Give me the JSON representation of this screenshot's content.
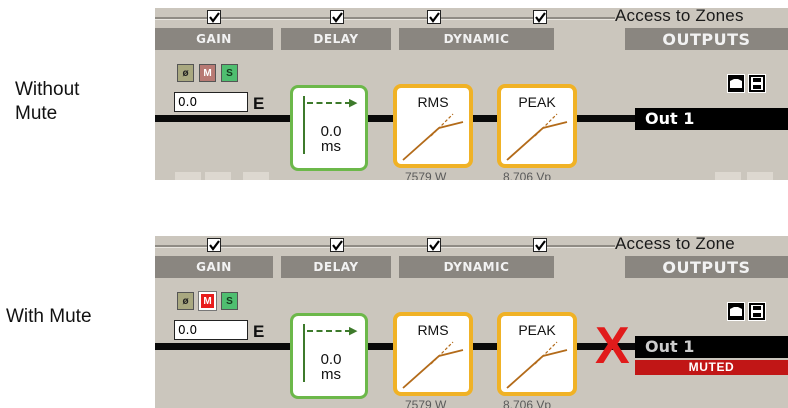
{
  "captions": {
    "top": [
      "Without",
      "Mute"
    ],
    "bottom": "With Mute"
  },
  "panels": [
    {
      "id": "without",
      "access_label": "Access to Zones",
      "sections": {
        "gain": "GAIN",
        "delay": "DELAY",
        "dynamic": "DYNAMIC",
        "outputs": "OUTPUTS"
      },
      "buttons": {
        "phase": "ø",
        "mute": "M",
        "solo": "S"
      },
      "mute_active": false,
      "gain_value": "0.0",
      "e_label": "E",
      "delay_value": [
        "0.0",
        "ms"
      ],
      "rms_label": "RMS",
      "peak_label": "PEAK",
      "rms_value": "7579 W",
      "peak_value": "8.706 Vp",
      "output_name": "Out 1"
    },
    {
      "id": "with",
      "access_label": "Access to Zone",
      "sections": {
        "gain": "GAIN",
        "delay": "DELAY",
        "dynamic": "DYNAMIC",
        "outputs": "OUTPUTS"
      },
      "buttons": {
        "phase": "ø",
        "mute": "M",
        "solo": "S"
      },
      "mute_active": true,
      "gain_value": "0.0",
      "e_label": "E",
      "delay_value": [
        "0.0",
        "ms"
      ],
      "rms_label": "RMS",
      "peak_label": "PEAK",
      "rms_value": "7579 W",
      "peak_value": "8.706 Vp",
      "output_name": "Out 1",
      "muted_label": "MUTED",
      "x_mark": "X"
    }
  ],
  "colors": {
    "mute_active": "#e81c1c",
    "delay_border": "#6cb84a",
    "dyn_border": "#f0b226",
    "muted_bar": "#c11616"
  }
}
